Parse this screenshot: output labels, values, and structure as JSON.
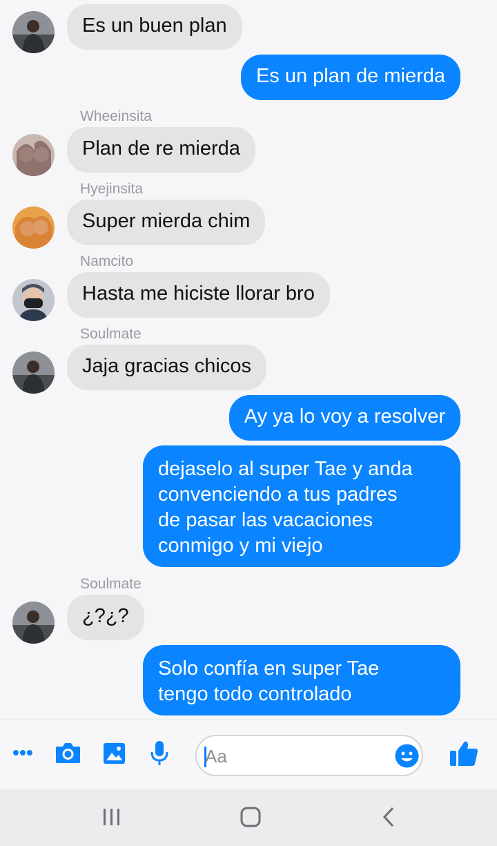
{
  "messages": [
    {
      "sender": "",
      "text": "Es un buen plan",
      "direction": "in"
    },
    {
      "sender": "",
      "text": "Es un plan de mierda",
      "direction": "out"
    },
    {
      "sender": "Wheeinsita",
      "text": "Plan de re mierda",
      "direction": "in"
    },
    {
      "sender": "Hyejinsita",
      "text": "Super mierda chim",
      "direction": "in"
    },
    {
      "sender": "Namcito",
      "text": "Hasta me hiciste llorar bro",
      "direction": "in"
    },
    {
      "sender": "Soulmate",
      "text": "Jaja gracias chicos",
      "direction": "in"
    },
    {
      "sender": "",
      "text": "Ay ya lo voy a resolver",
      "direction": "out"
    },
    {
      "sender": "",
      "text": "dejaselo al super Tae y anda\nconvenciendo a tus padres\nde pasar las vacaciones\nconmigo y mi viejo",
      "direction": "out"
    },
    {
      "sender": "Soulmate",
      "text": "¿?¿?",
      "direction": "in"
    },
    {
      "sender": "",
      "text": "Solo confía en super Tae\ntengo todo controlado",
      "direction": "out"
    }
  ],
  "composer": {
    "placeholder": "Aa",
    "icons": [
      "more-icon",
      "camera-icon",
      "gallery-icon",
      "microphone-icon",
      "emoji-icon",
      "thumbs-up-icon"
    ]
  },
  "navbar": {
    "icons": [
      "recent-apps-icon",
      "home-icon",
      "back-icon"
    ]
  },
  "colors": {
    "accent": "#0A84FF",
    "incoming_bubble": "#E4E4E7",
    "background": "#F6F6F8"
  }
}
